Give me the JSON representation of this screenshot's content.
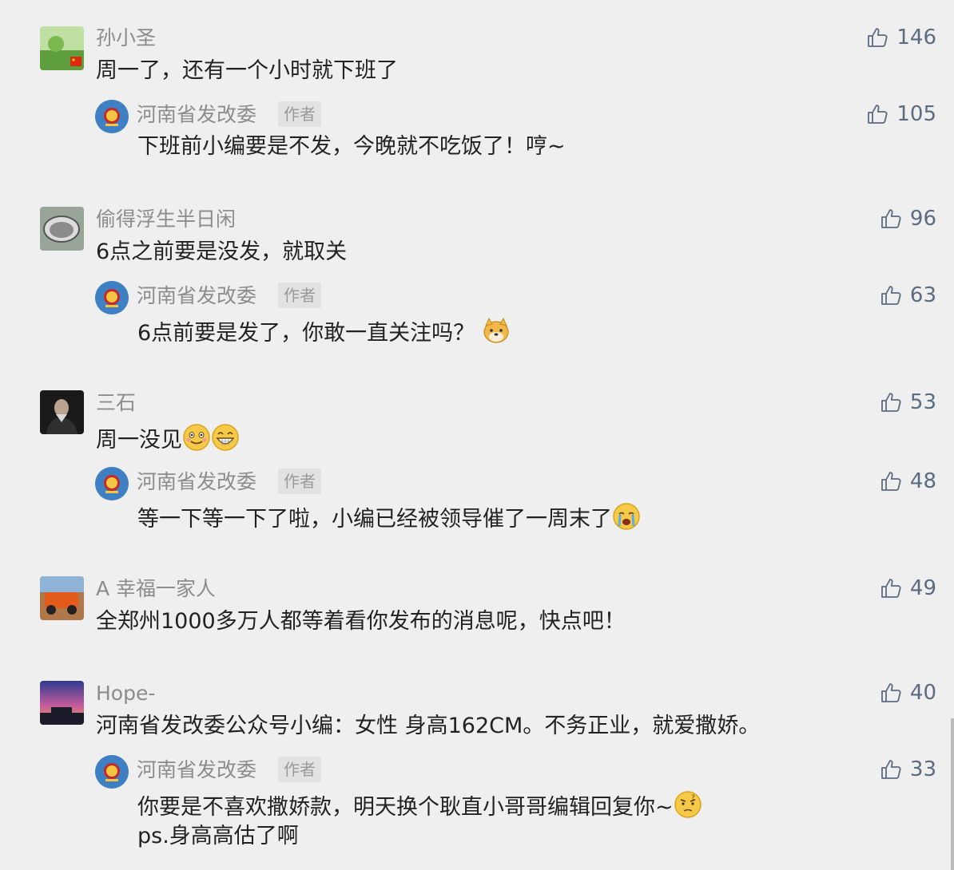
{
  "comments": [
    {
      "nick": "孙小圣",
      "content": "周一了，还有一个小时就下班了",
      "likes": "146",
      "reply": {
        "nick": "河南省发改委",
        "badge": "作者",
        "content": "下班前小编要是不发，今晚就不吃饭了！哼~",
        "likes": "105"
      }
    },
    {
      "nick": "偷得浮生半日闲",
      "content": "6点之前要是没发，就取关",
      "likes": "96",
      "reply": {
        "nick": "河南省发改委",
        "badge": "作者",
        "content": "6点前要是发了，你敢一直关注吗？",
        "likes": "63"
      }
    },
    {
      "nick": "三石",
      "content": "周一没见",
      "likes": "53",
      "reply": {
        "nick": "河南省发改委",
        "badge": "作者",
        "content": "等一下等一下了啦，小编已经被领导催了一周末了",
        "likes": "48"
      }
    },
    {
      "nick": "A 幸福一家人",
      "content": "全郑州1000多万人都等着看你发布的消息呢，快点吧！",
      "likes": "49"
    },
    {
      "nick": "Hope-",
      "content": "河南省发改委公众号小编：女性 身高162CM。不务正业，就爱撒娇。",
      "likes": "40",
      "reply": {
        "nick": "河南省发改委",
        "badge": "作者",
        "content_line1": "你要是不喜欢撒娇款，明天换个耿直小哥哥编辑回复你~",
        "content_line2": "ps.身高高估了啊",
        "likes": "33"
      }
    }
  ],
  "icons": {
    "like": "thumbs-up-icon",
    "emoji_doge": "doge-emoji-icon",
    "emoji_smile": "smile-emoji-icon",
    "emoji_grin": "grin-emoji-icon",
    "emoji_cry": "cry-emoji-icon",
    "emoji_think": "thinking-emoji-icon"
  },
  "colors": {
    "background": "#efefef",
    "nick": "#8c8c8c",
    "content": "#222222",
    "like": "#5b6b80",
    "author_avatar": "#3f7fc4"
  }
}
